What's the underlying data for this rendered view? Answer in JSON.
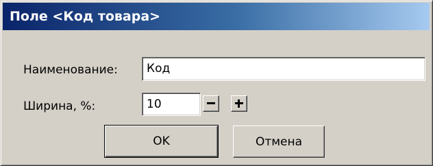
{
  "dialog": {
    "title": "Поле <Код товара>"
  },
  "form": {
    "name_label": "Наименование:",
    "name_value": "Код",
    "width_label": "Ширина, %:",
    "width_value": "10",
    "decrement_symbol": "−",
    "increment_symbol": "+"
  },
  "buttons": {
    "ok_label": "OK",
    "cancel_label": "Отмена"
  },
  "icons": {
    "decrement": "minus-icon",
    "increment": "plus-icon"
  }
}
